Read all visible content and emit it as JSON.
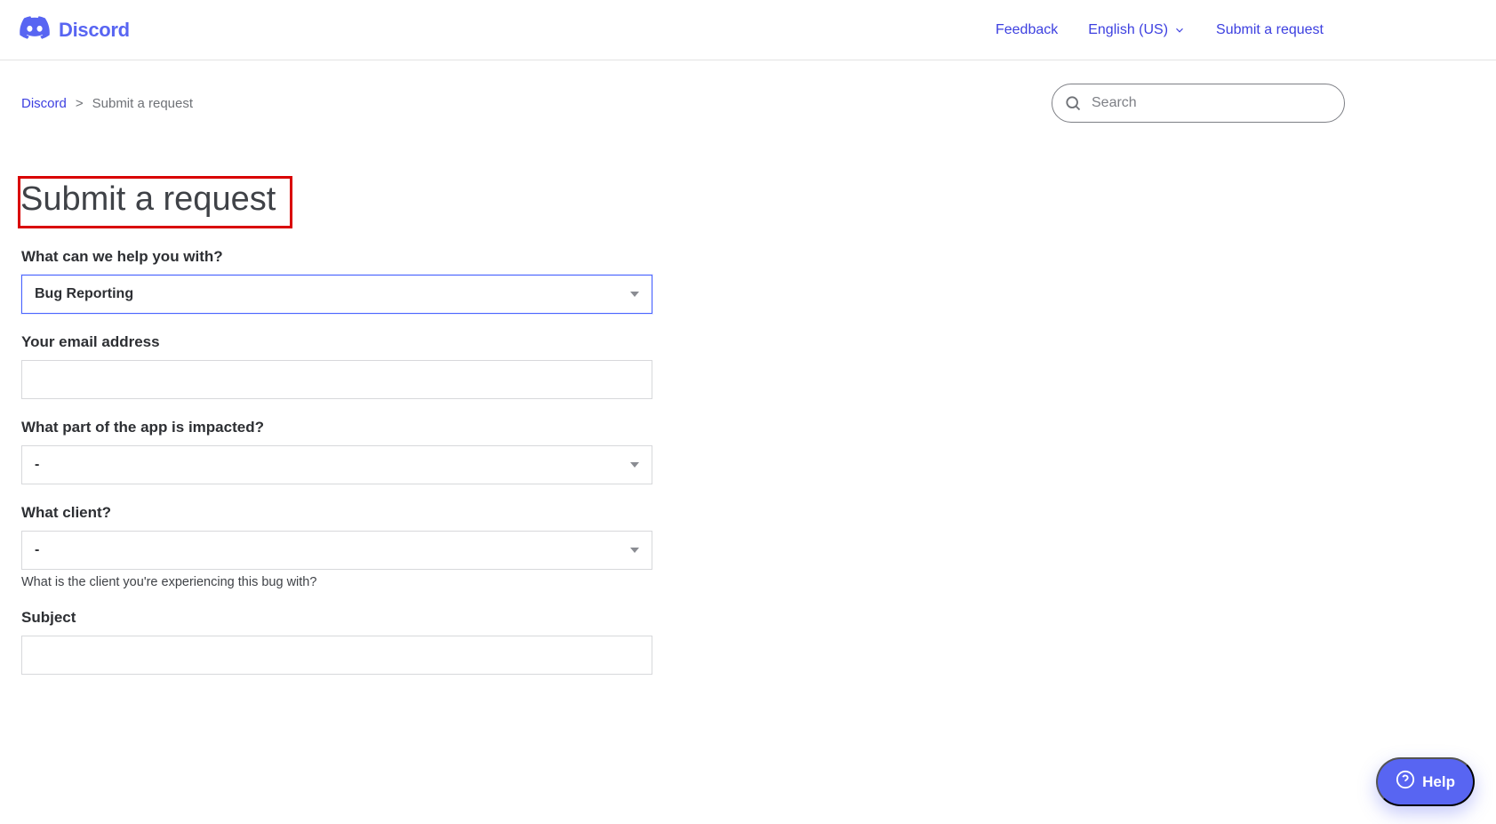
{
  "brand": {
    "name": "Discord"
  },
  "header": {
    "feedback": "Feedback",
    "language": "English (US)",
    "submit_link": "Submit a request"
  },
  "breadcrumb": {
    "root": "Discord",
    "current": "Submit a request"
  },
  "search": {
    "placeholder": "Search"
  },
  "page": {
    "title": "Submit a request"
  },
  "form": {
    "help_with": {
      "label": "What can we help you with?",
      "value": "Bug Reporting"
    },
    "email": {
      "label": "Your email address",
      "value": ""
    },
    "impacted_part": {
      "label": "What part of the app is impacted?",
      "value": "-"
    },
    "client": {
      "label": "What client?",
      "value": "-",
      "help": "What is the client you're experiencing this bug with?"
    },
    "subject": {
      "label": "Subject",
      "value": ""
    }
  },
  "help_button": {
    "label": "Help"
  }
}
